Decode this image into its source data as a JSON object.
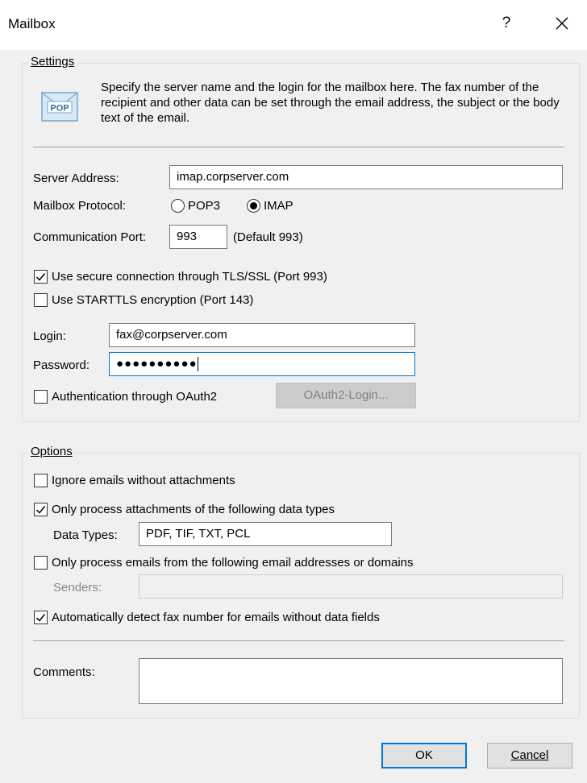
{
  "window": {
    "title": "Mailbox",
    "help_label": "?",
    "close_icon": "close-icon"
  },
  "settings": {
    "legend": "Settings",
    "icon_text": "POP",
    "description": "Specify the server name and the login for the mailbox here. The fax number of the recipient and other data can be set through the email address, the subject or the body text of the email.",
    "server_address_label": "Server Address:",
    "server_address_value": "imap.corpserver.com",
    "protocol_label": "Mailbox Protocol:",
    "protocol_options": [
      "POP3",
      "IMAP"
    ],
    "protocol_selected": "IMAP",
    "port_label": "Communication Port:",
    "port_value": "993",
    "port_hint": "(Default 993)",
    "tls_label": "Use secure connection through TLS/SSL (Port 993)",
    "tls_checked": true,
    "starttls_label": "Use STARTTLS encryption (Port 143)",
    "starttls_checked": false,
    "login_label": "Login:",
    "login_value": "fax@corpserver.com",
    "password_label": "Password:",
    "password_value": "●●●●●●●●●●",
    "oauth_label": "Authentication through OAuth2",
    "oauth_checked": false,
    "oauth_button": "OAuth2-Login..."
  },
  "options": {
    "legend": "Options",
    "ignore_label": "Ignore emails without attachments",
    "ignore_checked": false,
    "only_types_label": "Only process attachments of the following data types",
    "only_types_checked": true,
    "data_types_label": "Data Types:",
    "data_types_value": "PDF, TIF, TXT, PCL",
    "only_senders_label": "Only process emails from the following email addresses or domains",
    "only_senders_checked": false,
    "senders_label": "Senders:",
    "senders_value": "",
    "auto_detect_label": "Automatically detect fax number for emails without data fields",
    "auto_detect_checked": true,
    "comments_label": "Comments:",
    "comments_value": ""
  },
  "buttons": {
    "ok": "OK",
    "cancel": "Cancel"
  },
  "colors": {
    "accent": "#0078d7",
    "titlebar_bg": "#ffffff",
    "dialog_bg": "#f0f0f0"
  }
}
